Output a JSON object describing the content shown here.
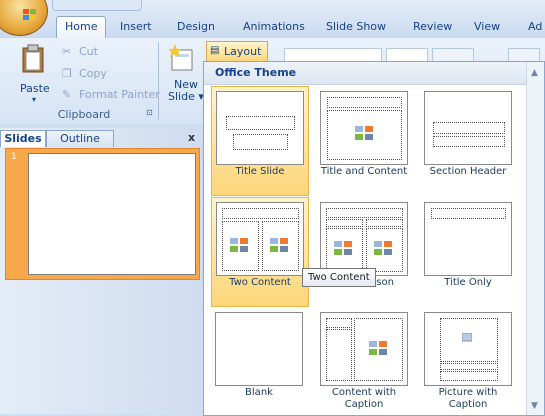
{
  "tabs": [
    {
      "label": "Home",
      "active": true
    },
    {
      "label": "Insert",
      "active": false
    },
    {
      "label": "Design",
      "active": false
    },
    {
      "label": "Animations",
      "active": false
    },
    {
      "label": "Slide Show",
      "active": false
    },
    {
      "label": "Review",
      "active": false
    },
    {
      "label": "View",
      "active": false
    },
    {
      "label": "Ad",
      "active": false
    }
  ],
  "ribbon": {
    "clipboard": {
      "paste": "Paste",
      "cut": "Cut",
      "copy": "Copy",
      "format_painter": "Format Painter",
      "group_label": "Clipboard"
    },
    "slides": {
      "new_slide": "New",
      "new_slide_2": "Slide ▾",
      "layout": "Layout ▾"
    }
  },
  "pane": {
    "tab_slides": "Slides",
    "tab_outline": "Outline",
    "close": "x",
    "slide_number": "1"
  },
  "gallery": {
    "header": "Office Theme",
    "tooltip": "Two Content",
    "layouts": [
      {
        "label": "Title Slide",
        "selected": true
      },
      {
        "label": "Title and Content",
        "selected": false
      },
      {
        "label": "Section Header",
        "selected": false
      },
      {
        "label": "Two Content",
        "selected": true
      },
      {
        "label": "Comparison",
        "selected": false
      },
      {
        "label": "Title Only",
        "selected": false
      },
      {
        "label": "Blank",
        "selected": false
      },
      {
        "label": "Content with Caption",
        "selected": false
      },
      {
        "label": "Picture with Caption",
        "selected": false
      }
    ]
  },
  "colors": {
    "accent_selected": "#fcd679",
    "thumb_selected": "#f8a74a",
    "ribbon_text": "#15428b"
  }
}
